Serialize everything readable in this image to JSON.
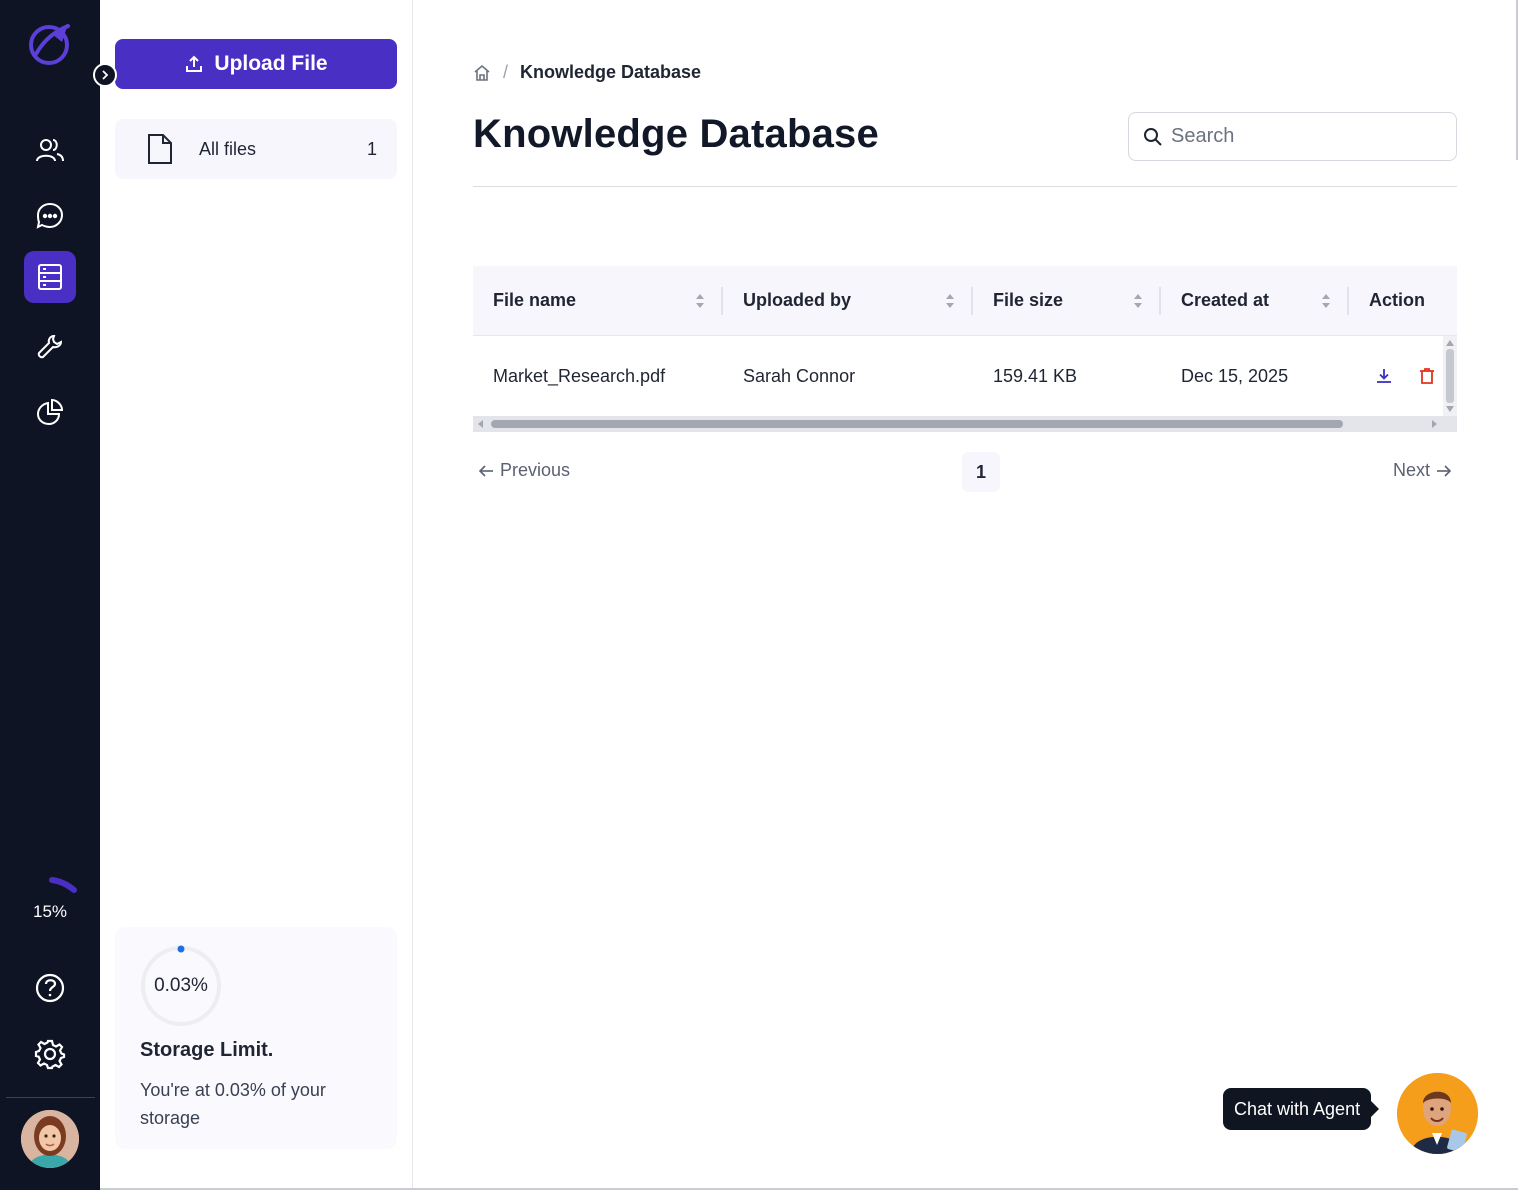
{
  "sidebar": {
    "usage_percent": "15%",
    "nav_icons": [
      "users-icon",
      "chat-icon",
      "database-icon",
      "wrench-icon",
      "pie-chart-icon"
    ],
    "bottom_icons": [
      "help-icon",
      "settings-icon"
    ],
    "active_item": "database-icon",
    "accent_color": "#4a2fc4"
  },
  "files_panel": {
    "upload_label": "Upload File",
    "folders": [
      {
        "label": "All files",
        "count": "1"
      }
    ],
    "storage": {
      "percent": "0.03%",
      "title": "Storage Limit.",
      "description": "You're at 0.03% of your storage"
    }
  },
  "main": {
    "breadcrumb": {
      "separator": "/",
      "current": "Knowledge Database"
    },
    "title": "Knowledge Database",
    "search": {
      "placeholder": "Search",
      "value": ""
    },
    "table": {
      "columns": [
        "File name",
        "Uploaded by",
        "File size",
        "Created at",
        "Action"
      ],
      "rows": [
        {
          "file_name": "Market_Research.pdf",
          "uploaded_by": "Sarah Connor",
          "file_size": "159.41 KB",
          "created_at": "Dec 15, 2025"
        }
      ]
    },
    "pagination": {
      "previous": "Previous",
      "current_page": "1",
      "next": "Next"
    },
    "chat": {
      "label": "Chat with Agent"
    }
  }
}
